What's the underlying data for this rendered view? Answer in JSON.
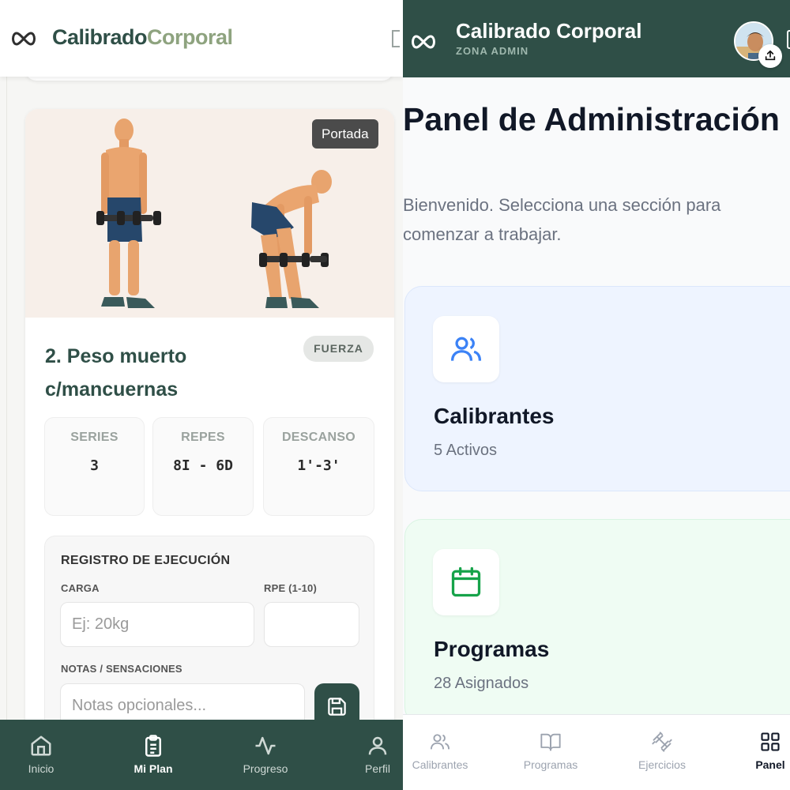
{
  "left": {
    "brand_part1": "Calibrado",
    "brand_part2": "Corporal",
    "exercise": {
      "cover_badge": "Portada",
      "title": "2. Peso muerto c/mancuernas",
      "tag": "FUERZA",
      "stats": [
        {
          "label": "SERIES",
          "value": "3"
        },
        {
          "label": "REPES",
          "value": "8I - 6D"
        },
        {
          "label": "DESCANSO",
          "value": "1'-3'"
        }
      ],
      "log": {
        "title": "REGISTRO DE EJECUCIÓN",
        "load_label": "CARGA",
        "load_placeholder": "Ej: 20kg",
        "rpe_label": "RPE (1-10)",
        "notes_label": "NOTAS / SENSACIONES",
        "notes_placeholder": "Notas opcionales..."
      }
    },
    "nav": [
      {
        "label": "Inicio",
        "icon": "home-icon"
      },
      {
        "label": "Mi Plan",
        "icon": "clipboard-icon",
        "active": true
      },
      {
        "label": "Progreso",
        "icon": "activity-icon"
      },
      {
        "label": "Perfil",
        "icon": "user-icon"
      }
    ]
  },
  "right": {
    "app_title": "Calibrado Corporal",
    "app_subtitle": "ZONA ADMIN",
    "page_title": "Panel de Administración",
    "page_description": "Bienvenido. Selecciona una sección para comenzar a trabajar.",
    "sections": [
      {
        "name": "Calibrantes",
        "count": "5 Activos",
        "icon": "users-icon",
        "color": "#3b82f6"
      },
      {
        "name": "Programas",
        "count": "28 Asignados",
        "icon": "calendar-icon",
        "color": "#16a34a"
      }
    ],
    "nav": [
      {
        "label": "Calibrantes",
        "icon": "users-icon"
      },
      {
        "label": "Programas",
        "icon": "book-icon"
      },
      {
        "label": "Ejercicios",
        "icon": "dumbbell-icon"
      },
      {
        "label": "Panel",
        "icon": "grid-icon",
        "active": true
      }
    ]
  },
  "colors": {
    "primary": "#2f4f47",
    "brand_accent": "#8ea37f"
  }
}
